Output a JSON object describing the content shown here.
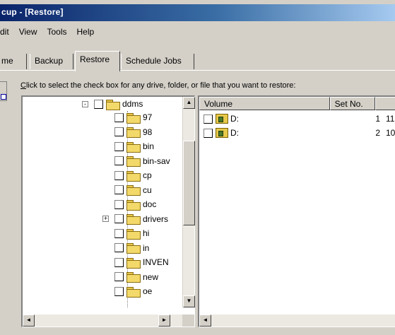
{
  "window": {
    "title": "cup - [Restore]"
  },
  "menu": [
    "dit",
    "View",
    "Tools",
    "Help"
  ],
  "tabs": [
    "me",
    "Backup",
    "Restore",
    "Schedule Jobs"
  ],
  "active_tab": "Restore",
  "instruction": {
    "accel": "C",
    "rest": "lick to select the check box for any drive, folder, or file that you want to restore:"
  },
  "tree": {
    "root": {
      "label": "ddms",
      "expander": "-"
    },
    "items": [
      {
        "label": "97"
      },
      {
        "label": "98"
      },
      {
        "label": "bin"
      },
      {
        "label": "bin-sav"
      },
      {
        "label": "cp"
      },
      {
        "label": "cu"
      },
      {
        "label": "doc"
      },
      {
        "label": "drivers",
        "expander": "+"
      },
      {
        "label": "hi"
      },
      {
        "label": "in"
      },
      {
        "label": "INVEN"
      },
      {
        "label": "new"
      },
      {
        "label": "oe"
      }
    ]
  },
  "list": {
    "columns": [
      "Volume",
      "Set No.",
      ""
    ],
    "rows": [
      {
        "volume": "D:",
        "set_no": "1",
        "extra": "11"
      },
      {
        "volume": "D:",
        "set_no": "2",
        "extra": "10"
      }
    ]
  },
  "icons": {
    "folder": "folder-icon",
    "volume": "backup-volume-icon",
    "scroll_up": "▲",
    "scroll_down": "▼",
    "scroll_left": "◄",
    "scroll_right": "►"
  },
  "colors": {
    "titlebar_start": "#0a246a",
    "titlebar_end": "#a6caf0",
    "face": "#d4d0c8",
    "folder": "#f3d96a"
  }
}
